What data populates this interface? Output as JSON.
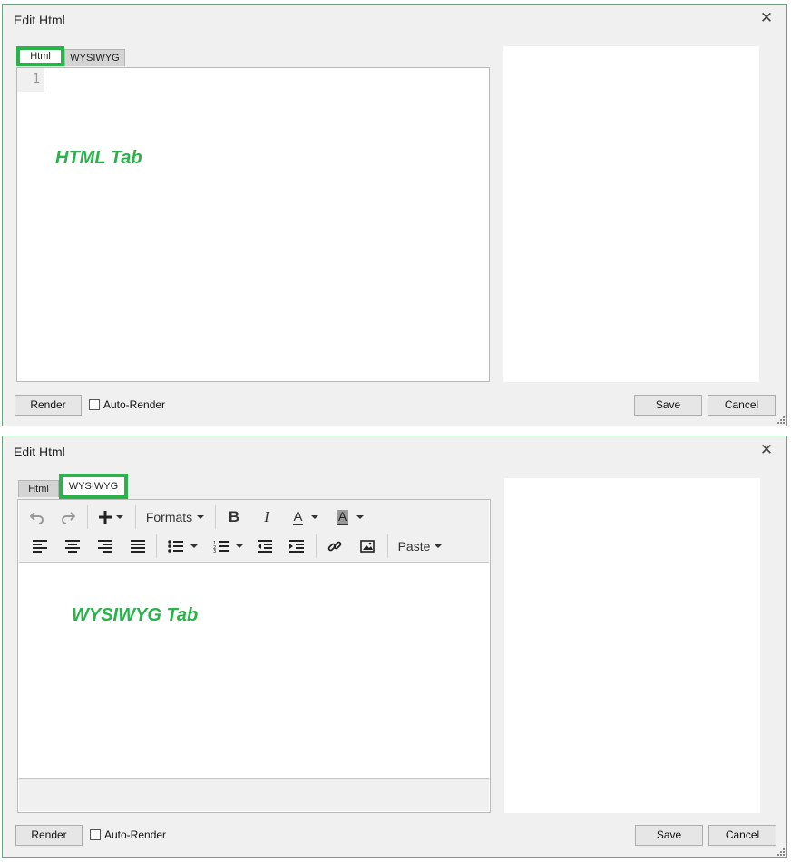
{
  "dialogs": [
    {
      "title": "Edit Html",
      "tabs": [
        "Html",
        "WYSIWYG"
      ],
      "active_tab": "Html",
      "line_number": "1",
      "overlay_label": "HTML Tab",
      "render_button": "Render",
      "auto_render_label": "Auto-Render",
      "auto_render_checked": false,
      "save_button": "Save",
      "cancel_button": "Cancel"
    },
    {
      "title": "Edit Html",
      "tabs": [
        "Html",
        "WYSIWYG"
      ],
      "active_tab": "WYSIWYG",
      "toolbar": {
        "formats_label": "Formats",
        "paste_label": "Paste"
      },
      "overlay_label": "WYSIWYG Tab",
      "render_button": "Render",
      "auto_render_label": "Auto-Render",
      "auto_render_checked": false,
      "save_button": "Save",
      "cancel_button": "Cancel"
    }
  ],
  "colors": {
    "highlight": "#2ab24b",
    "dialog_bg": "#f0f0f0",
    "dialog_border": "#6aa37f"
  },
  "icons": {
    "close": "close-icon",
    "undo": "undo-icon",
    "redo": "redo-icon",
    "insert": "plus-icon",
    "bold": "bold-icon",
    "italic": "italic-icon",
    "text_color": "text-color-icon",
    "background_color": "background-color-icon",
    "align_left": "align-left-icon",
    "align_center": "align-center-icon",
    "align_right": "align-right-icon",
    "align_justify": "align-justify-icon",
    "bullet_list": "bullet-list-icon",
    "numbered_list": "numbered-list-icon",
    "outdent": "outdent-icon",
    "indent": "indent-icon",
    "link": "link-icon",
    "image": "image-icon"
  }
}
